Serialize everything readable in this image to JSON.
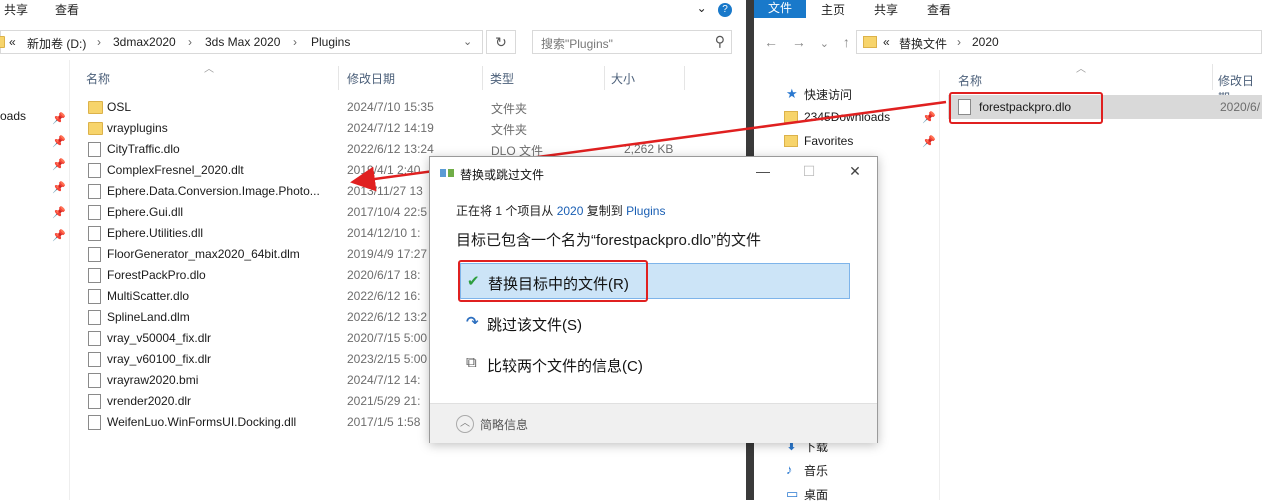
{
  "left_window": {
    "menu": [
      "共享",
      "查看"
    ],
    "window_controls": [
      "chevron-down",
      "help"
    ],
    "breadcrumb": [
      "«",
      "新加卷 (D:)",
      "3dmax2020",
      "3ds Max 2020",
      "Plugins"
    ],
    "search_placeholder": "搜索\"Plugins\"",
    "nav_partial_label": "oads",
    "columns": {
      "name": "名称",
      "date": "修改日期",
      "type": "类型",
      "size": "大小"
    },
    "files": [
      {
        "name": "OSL",
        "date": "2024/7/10 15:35",
        "type": "文件夹",
        "size": "",
        "kind": "folder"
      },
      {
        "name": "vrayplugins",
        "date": "2024/7/12 14:19",
        "type": "文件夹",
        "size": "",
        "kind": "folder"
      },
      {
        "name": "CityTraffic.dlo",
        "date": "2022/6/12 13:24",
        "type": "DLO 文件",
        "size": "2,262 KB",
        "kind": "file"
      },
      {
        "name": "ComplexFresnel_2020.dlt",
        "date": "2019/4/1 2:40",
        "type": "",
        "size": "",
        "kind": "file"
      },
      {
        "name": "Ephere.Data.Conversion.Image.Photo...",
        "date": "2013/11/27 13",
        "type": "",
        "size": "",
        "kind": "file"
      },
      {
        "name": "Ephere.Gui.dll",
        "date": "2017/10/4 22:5",
        "type": "",
        "size": "",
        "kind": "file"
      },
      {
        "name": "Ephere.Utilities.dll",
        "date": "2014/12/10 1:",
        "type": "",
        "size": "",
        "kind": "file"
      },
      {
        "name": "FloorGenerator_max2020_64bit.dlm",
        "date": "2019/4/9 17:27",
        "type": "",
        "size": "",
        "kind": "file"
      },
      {
        "name": "ForestPackPro.dlo",
        "date": "2020/6/17 18:",
        "type": "",
        "size": "",
        "kind": "file"
      },
      {
        "name": "MultiScatter.dlo",
        "date": "2022/6/12 16:",
        "type": "",
        "size": "",
        "kind": "file"
      },
      {
        "name": "SplineLand.dlm",
        "date": "2022/6/12 13:2",
        "type": "",
        "size": "",
        "kind": "file"
      },
      {
        "name": "vray_v50004_fix.dlr",
        "date": "2020/7/15 5:00",
        "type": "",
        "size": "",
        "kind": "file"
      },
      {
        "name": "vray_v60100_fix.dlr",
        "date": "2023/2/15 5:00",
        "type": "",
        "size": "",
        "kind": "file"
      },
      {
        "name": "vrayraw2020.bmi",
        "date": "2024/7/12 14:",
        "type": "",
        "size": "",
        "kind": "file"
      },
      {
        "name": "vrender2020.dlr",
        "date": "2021/5/29 21:",
        "type": "",
        "size": "",
        "kind": "file"
      },
      {
        "name": "WeifenLuo.WinFormsUI.Docking.dll",
        "date": "2017/1/5 1:58",
        "type": "",
        "size": "",
        "kind": "file"
      }
    ]
  },
  "right_window": {
    "ribbon": [
      "文件",
      "主页",
      "共享",
      "查看"
    ],
    "breadcrumb": [
      "«",
      "替换文件",
      "2020"
    ],
    "nav": [
      {
        "label": "快速访问",
        "icon": "star-icon",
        "pinned": false
      },
      {
        "label": "2345Downloads",
        "icon": "folder-icon",
        "pinned": true
      },
      {
        "label": "Favorites",
        "icon": "folder-icon",
        "pinned": true
      },
      {
        "label": "下载",
        "icon": "download-icon",
        "pinned": false
      },
      {
        "label": "音乐",
        "icon": "music-icon",
        "pinned": false
      },
      {
        "label": "桌面",
        "icon": "desktop-icon",
        "pinned": false
      }
    ],
    "columns": {
      "name": "名称",
      "date": "修改日期"
    },
    "file": {
      "name": "forestpackpro.dlo",
      "date": "2020/6/"
    }
  },
  "dialog": {
    "title": "替换或跳过文件",
    "progress_prefix": "正在将 1 个项目从",
    "progress_from": "2020",
    "progress_mid": "复制到",
    "progress_to": "Plugins",
    "headline": "目标已包含一个名为“forestpackpro.dlo”的文件",
    "options": {
      "replace": "替换目标中的文件(R)",
      "skip": "跳过该文件(S)",
      "compare": "比较两个文件的信息(C)"
    },
    "footer": "简略信息"
  },
  "colors": {
    "accent": "#1979ca",
    "highlight": "#e02020",
    "selection": "#cce4f7"
  }
}
